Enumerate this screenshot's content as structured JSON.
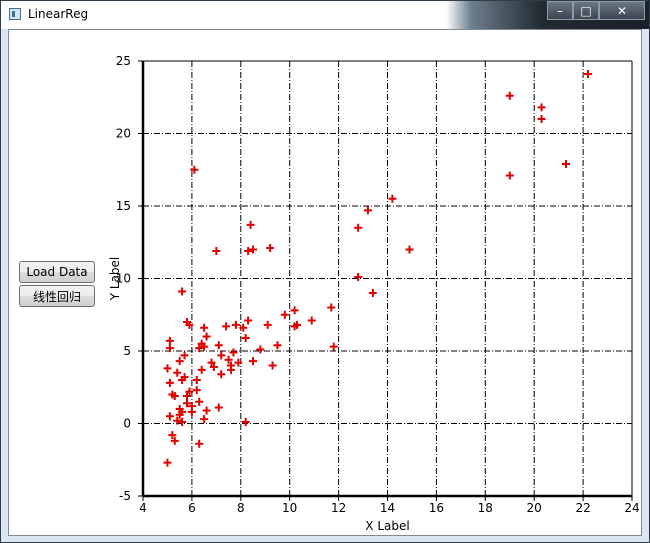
{
  "window": {
    "title": "LinearReg",
    "controls": {
      "minimize": "–",
      "maximize": "□",
      "close": "✕"
    }
  },
  "buttons": {
    "load_data": "Load Data",
    "linear_regression": "线性回归"
  },
  "chart_data": {
    "type": "scatter",
    "xlabel": "X Label",
    "ylabel": "Y Label",
    "xlim": [
      4,
      24
    ],
    "ylim": [
      -5,
      25
    ],
    "x_ticks": [
      4,
      6,
      8,
      10,
      12,
      14,
      16,
      18,
      20,
      22,
      24
    ],
    "y_ticks": [
      -5,
      0,
      5,
      10,
      15,
      20,
      25
    ],
    "grid": true,
    "marker": "+",
    "marker_color": "#e00000",
    "points": [
      [
        5.0,
        -2.7
      ],
      [
        5.1,
        5.7
      ],
      [
        5.1,
        5.2
      ],
      [
        5.0,
        3.8
      ],
      [
        5.1,
        2.8
      ],
      [
        5.2,
        2.0
      ],
      [
        5.1,
        0.5
      ],
      [
        5.2,
        -0.8
      ],
      [
        5.3,
        -1.2
      ],
      [
        5.3,
        1.9
      ],
      [
        5.4,
        0.2
      ],
      [
        5.4,
        3.5
      ],
      [
        5.5,
        0.6
      ],
      [
        5.5,
        1.0
      ],
      [
        5.5,
        4.3
      ],
      [
        5.6,
        9.1
      ],
      [
        5.6,
        3.0
      ],
      [
        5.6,
        0.8
      ],
      [
        5.6,
        0.1
      ],
      [
        5.7,
        4.7
      ],
      [
        5.7,
        3.2
      ],
      [
        5.8,
        1.9
      ],
      [
        5.8,
        1.4
      ],
      [
        5.8,
        7.0
      ],
      [
        5.9,
        6.8
      ],
      [
        5.9,
        2.2
      ],
      [
        6.0,
        1.2
      ],
      [
        6.0,
        0.8
      ],
      [
        6.1,
        17.5
      ],
      [
        6.2,
        3.0
      ],
      [
        6.2,
        2.3
      ],
      [
        6.3,
        5.2
      ],
      [
        6.3,
        1.5
      ],
      [
        6.3,
        -1.4
      ],
      [
        6.4,
        5.5
      ],
      [
        6.4,
        3.7
      ],
      [
        6.5,
        6.6
      ],
      [
        6.5,
        5.3
      ],
      [
        6.5,
        0.3
      ],
      [
        6.6,
        6.0
      ],
      [
        6.6,
        0.9
      ],
      [
        6.8,
        4.2
      ],
      [
        6.9,
        3.9
      ],
      [
        7.0,
        11.9
      ],
      [
        7.1,
        5.4
      ],
      [
        7.1,
        1.1
      ],
      [
        7.2,
        4.7
      ],
      [
        7.2,
        3.4
      ],
      [
        7.4,
        6.7
      ],
      [
        7.5,
        4.4
      ],
      [
        7.6,
        4.0
      ],
      [
        7.6,
        3.7
      ],
      [
        7.7,
        4.9
      ],
      [
        7.8,
        6.8
      ],
      [
        7.9,
        4.2
      ],
      [
        8.1,
        6.6
      ],
      [
        8.2,
        5.9
      ],
      [
        8.2,
        0.1
      ],
      [
        8.3,
        7.1
      ],
      [
        8.3,
        11.9
      ],
      [
        8.4,
        13.7
      ],
      [
        8.5,
        12.0
      ],
      [
        8.5,
        4.3
      ],
      [
        8.8,
        5.1
      ],
      [
        9.1,
        6.8
      ],
      [
        9.2,
        12.1
      ],
      [
        9.3,
        4.0
      ],
      [
        9.5,
        5.4
      ],
      [
        9.8,
        7.5
      ],
      [
        10.2,
        6.7
      ],
      [
        10.2,
        7.8
      ],
      [
        10.3,
        6.8
      ],
      [
        10.9,
        7.1
      ],
      [
        11.7,
        8.0
      ],
      [
        11.8,
        5.3
      ],
      [
        12.8,
        13.5
      ],
      [
        12.8,
        10.1
      ],
      [
        13.2,
        14.7
      ],
      [
        13.4,
        9.0
      ],
      [
        14.2,
        15.5
      ],
      [
        14.9,
        12.0
      ],
      [
        19.0,
        22.6
      ],
      [
        19.0,
        17.1
      ],
      [
        20.3,
        21.8
      ],
      [
        20.3,
        21.0
      ],
      [
        21.3,
        17.9
      ],
      [
        22.2,
        24.1
      ]
    ]
  }
}
